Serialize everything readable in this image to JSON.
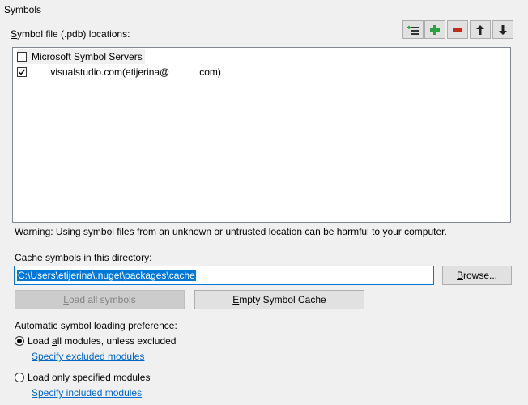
{
  "group": {
    "title": "Symbols"
  },
  "locations": {
    "label_access": "S",
    "label_rest": "ymbol file (.pdb) locations:",
    "items": [
      {
        "label": "Microsoft Symbol Servers",
        "checked": false
      },
      {
        "label_prefix": "",
        "label_mid": ".visualstudio.com(etijerina@",
        "label_suffix": "com)",
        "checked": true
      }
    ]
  },
  "toolbar": {
    "buttons": [
      {
        "name": "load-all-symbols-toolbar-icon",
        "icon": "list-load-icon"
      },
      {
        "name": "add-location-button",
        "icon": "plus-icon"
      },
      {
        "name": "remove-location-button",
        "icon": "minus-icon"
      },
      {
        "name": "move-up-button",
        "icon": "arrow-up-icon"
      },
      {
        "name": "move-down-button",
        "icon": "arrow-down-icon"
      }
    ],
    "accent_green": "#2ea043",
    "accent_red": "#c42b1c"
  },
  "warning": "Warning: Using symbol files from an unknown or untrusted location can be harmful to your computer.",
  "cache": {
    "label_access": "C",
    "label_rest": "ache symbols in this directory:",
    "value": "C:\\Users\\etijerina\\.nuget\\packages\\cache",
    "browse_access": "B",
    "browse_rest": "rowse..."
  },
  "actions": {
    "load_access": "L",
    "load_rest": "oad all symbols",
    "empty_access": "E",
    "empty_rest": "mpty Symbol Cache"
  },
  "preference": {
    "label": "Automatic symbol loading preference:",
    "option_all_pre": "Load ",
    "option_all_access": "a",
    "option_all_post": "ll modules, unless excluded",
    "option_all_selected": true,
    "link_excluded": "Specify excluded modules",
    "option_only_pre": "Load ",
    "option_only_access": "o",
    "option_only_post": "nly specified modules",
    "option_only_selected": false,
    "link_included": "Specify included modules"
  }
}
